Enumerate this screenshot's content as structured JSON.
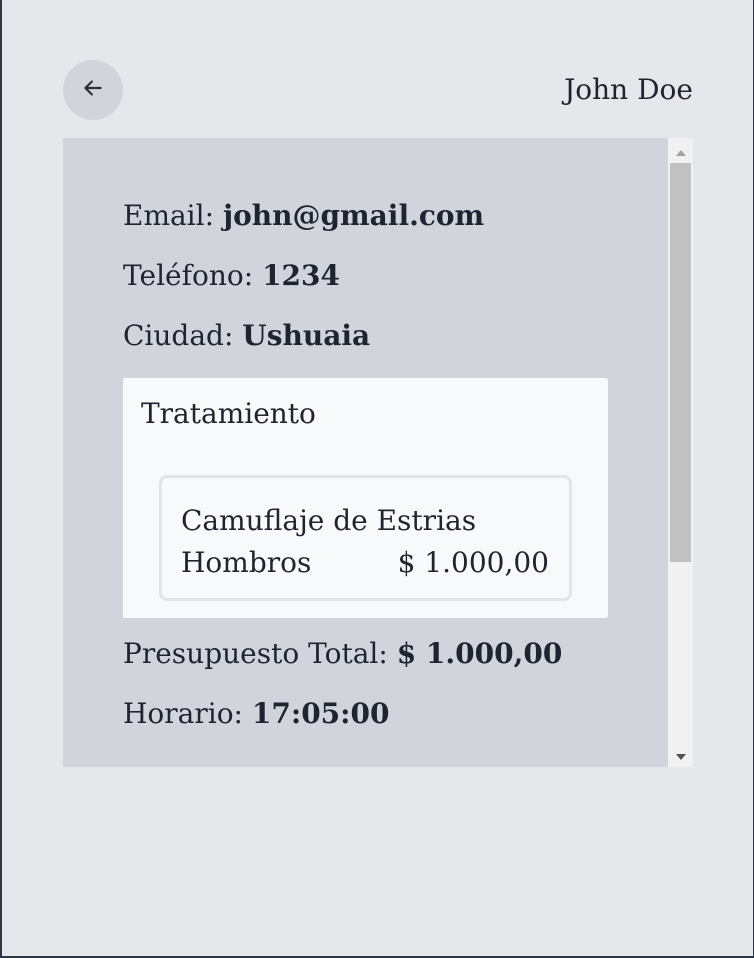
{
  "header": {
    "user_name": "John Doe"
  },
  "details": {
    "email_label": "Email:",
    "email_value": "john@gmail.com",
    "phone_label": "Teléfono:",
    "phone_value": "1234",
    "city_label": "Ciudad:",
    "city_value": "Ushuaia",
    "treatment": {
      "title": "Tratamiento",
      "items": [
        {
          "name": "Camuflaje de Estrias",
          "zone": "Hombros",
          "price": "$ 1.000,00"
        }
      ]
    },
    "budget_label": "Presupuesto Total:",
    "budget_value": "$ 1.000,00",
    "schedule_label": "Horario:",
    "schedule_value": "17:05:00"
  },
  "colors": {
    "background": "#e5e7eb",
    "panel": "#d1d5db",
    "card": "#f8f9fa",
    "text": "#1f2430"
  },
  "icons": {
    "back": "arrow-left-icon",
    "scroll_up": "triangle-up-icon",
    "scroll_down": "triangle-down-icon"
  }
}
